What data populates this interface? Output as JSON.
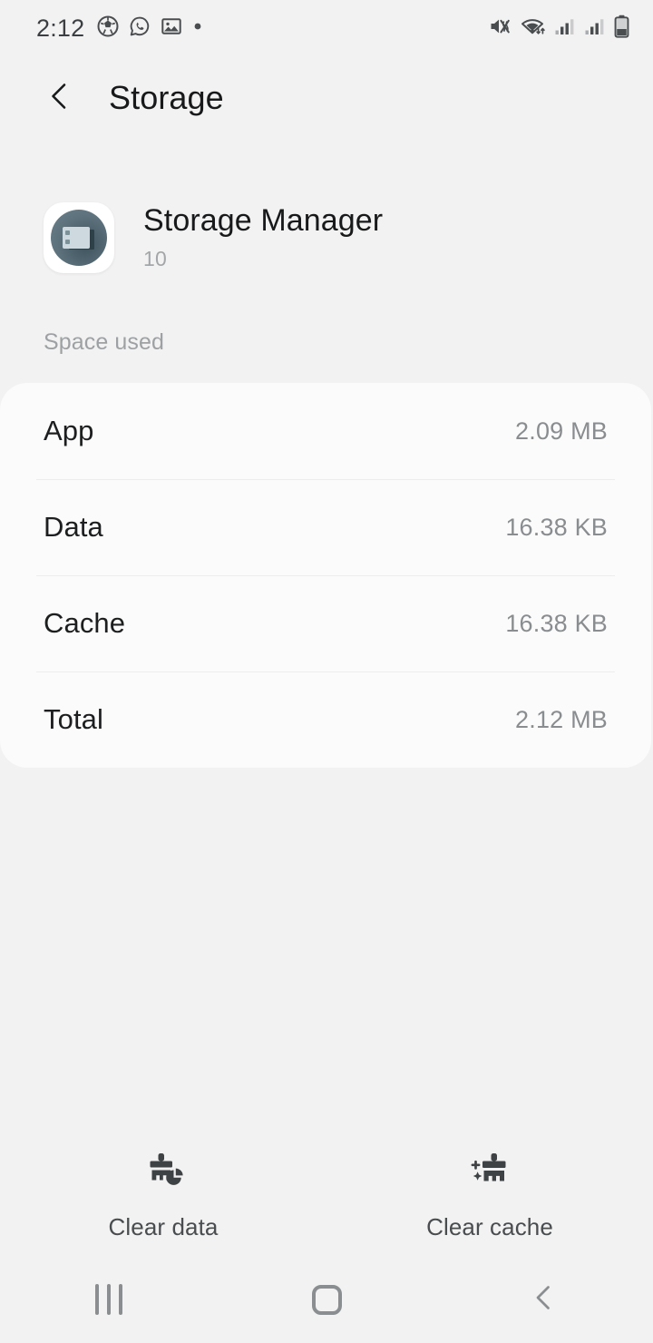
{
  "status_bar": {
    "clock": "2:12",
    "left_icons": [
      "soccer-ball-icon",
      "whatsapp-icon",
      "gallery-image-icon",
      "dot-indicator-icon"
    ],
    "right_icons": [
      "mute-vibrate-icon",
      "wifi-data-transfer-icon",
      "signal-bars-sim1-icon",
      "signal-bars-sim2-icon",
      "battery-icon"
    ]
  },
  "app_bar": {
    "back_icon": "chevron-left-icon",
    "title": "Storage"
  },
  "app_header": {
    "icon": "storage-manager-app-icon",
    "name": "Storage Manager",
    "version": "10"
  },
  "space_used": {
    "section_label": "Space used",
    "rows": [
      {
        "label": "App",
        "value": "2.09 MB"
      },
      {
        "label": "Data",
        "value": "16.38 KB"
      },
      {
        "label": "Cache",
        "value": "16.38 KB"
      },
      {
        "label": "Total",
        "value": "2.12 MB"
      }
    ]
  },
  "actions": [
    {
      "label": "Clear data",
      "icon": "brush-pie-chart-icon"
    },
    {
      "label": "Clear cache",
      "icon": "brush-sparkle-icon"
    }
  ],
  "nav_bar": {
    "recents_icon": "recents-icon",
    "home_icon": "home-icon",
    "back_icon": "back-chevron-icon"
  },
  "colors": {
    "background": "#f2f2f2",
    "card": "#fbfbfb",
    "primary_text": "#18191a",
    "secondary_text": "#8a8d8f",
    "divider": "#ededed",
    "app_icon": "#5d727c"
  }
}
